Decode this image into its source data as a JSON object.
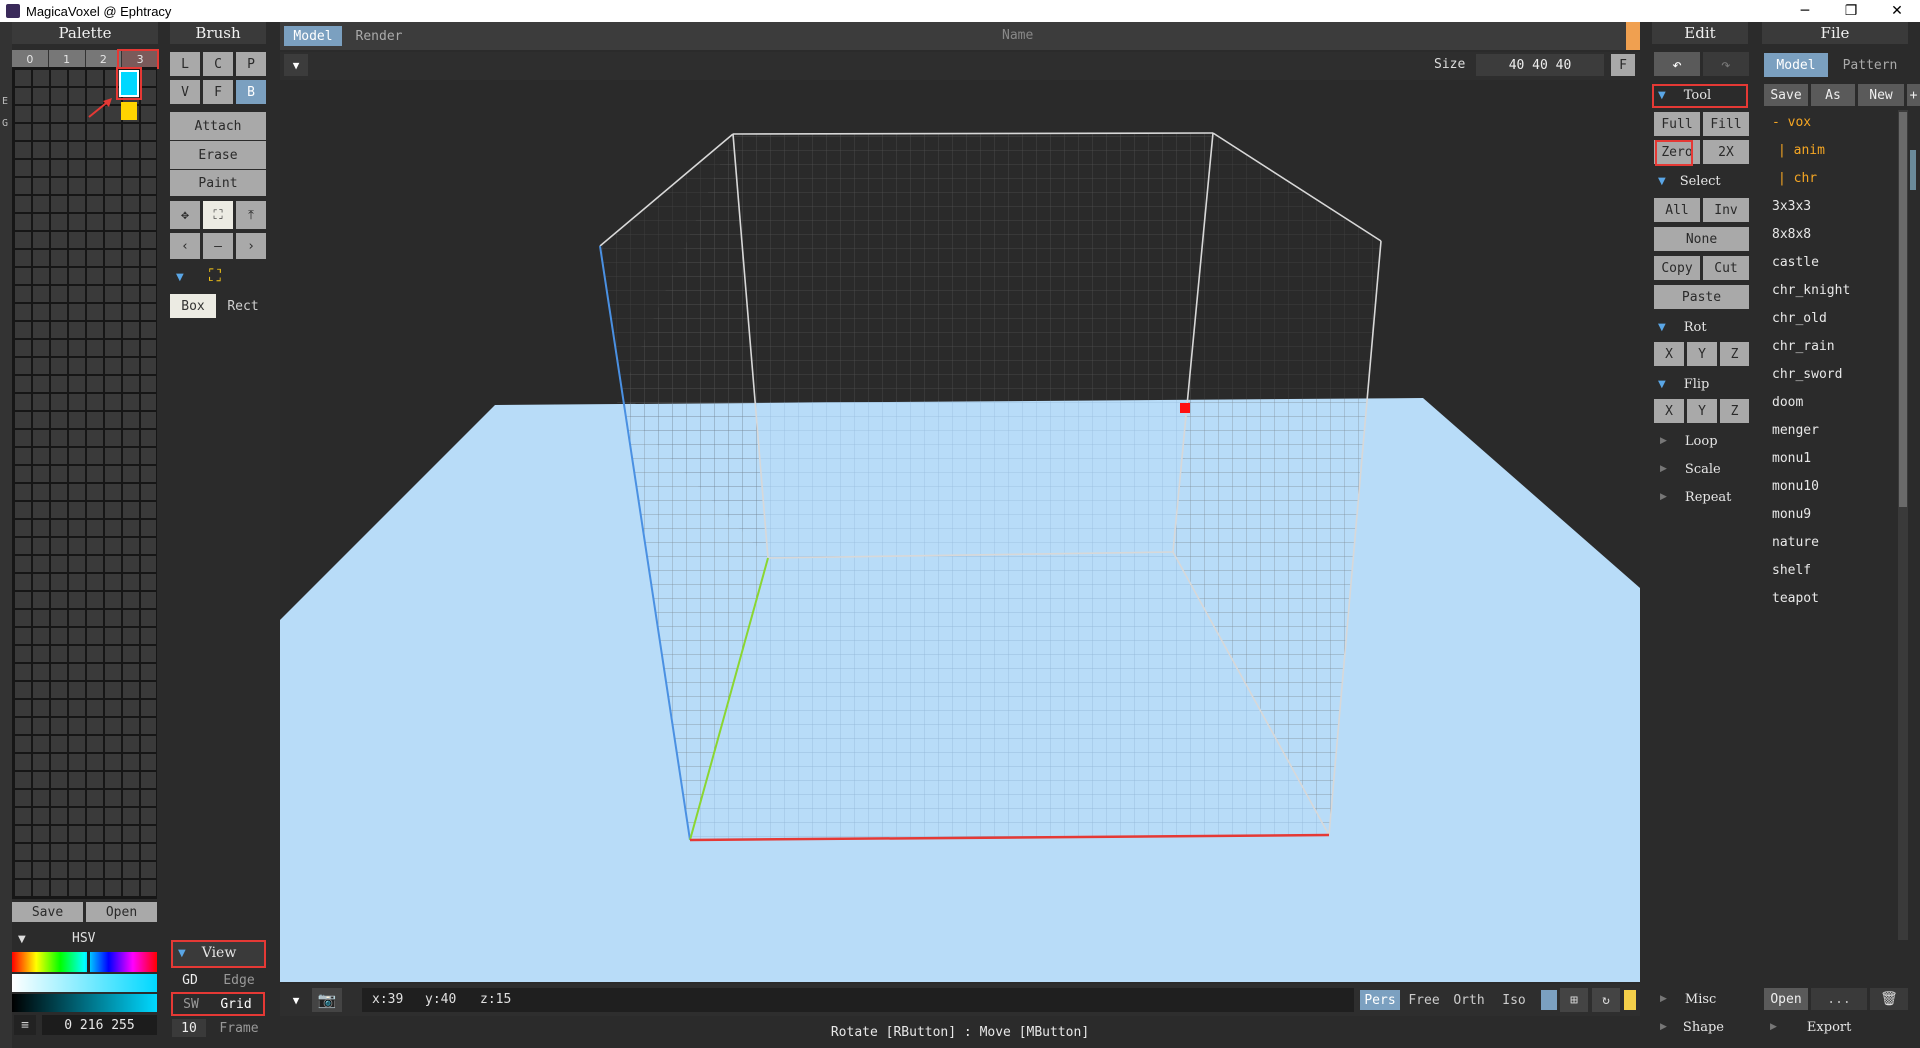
{
  "window": {
    "title": "MagicaVoxel @ Ephtracy",
    "minimize": "─",
    "restore": "❐",
    "close": "✕"
  },
  "palette": {
    "title": "Palette",
    "tabs": [
      "0",
      "1",
      "2",
      "3"
    ],
    "side_labels": [
      "E",
      "G"
    ],
    "save": "Save",
    "open": "Open",
    "hsv_label": "HSV",
    "color_value": "0 216 255",
    "menu_icon": "≡",
    "selected_color": "#00d8ff",
    "second_color": "#ffd400"
  },
  "brush": {
    "title": "Brush",
    "row1": [
      "L",
      "C",
      "P"
    ],
    "row2": [
      "V",
      "F",
      "B"
    ],
    "actions": [
      "Attach",
      "Erase",
      "Paint"
    ],
    "shape_box": "Box",
    "shape_rect": "Rect"
  },
  "view": {
    "title": "View",
    "gd": "GD",
    "edge": "Edge",
    "sw": "SW",
    "grid": "Grid",
    "frame_num": "10",
    "frame": "Frame"
  },
  "viewport": {
    "tab_model": "Model",
    "tab_render": "Render",
    "name": "Name",
    "size_label": "Size",
    "size_value": "40 40 40",
    "f_button": "F",
    "coords": {
      "x": "x:39",
      "y": "y:40",
      "z": "z:15"
    },
    "camera_modes": [
      "Pers",
      "Free",
      "Orth",
      "Iso"
    ],
    "hint": "Rotate [RButton] : Move [MButton]"
  },
  "edit": {
    "title": "Edit",
    "tool": "Tool",
    "full": "Full",
    "fill": "Fill",
    "zero": "Zero",
    "two_x": "2X",
    "select": "Select",
    "all": "All",
    "inv": "Inv",
    "none": "None",
    "copy": "Copy",
    "cut": "Cut",
    "paste": "Paste",
    "rot": "Rot",
    "flip": "Flip",
    "axes": [
      "X",
      "Y",
      "Z"
    ],
    "loop": "Loop",
    "scale": "Scale",
    "repeat": "Repeat",
    "misc": "Misc",
    "shape": "Shape"
  },
  "file": {
    "title": "File",
    "tab_model": "Model",
    "tab_pattern": "Pattern",
    "save": "Save",
    "as": "As",
    "new": "New",
    "plus": "+",
    "folder_vox": "- vox",
    "folder_anim": "| anim",
    "folder_chr": "| chr",
    "items": [
      "3x3x3",
      "8x8x8",
      "castle",
      "chr_knight",
      "chr_old",
      "chr_rain",
      "chr_sword",
      "doom",
      "menger",
      "monu1",
      "monu10",
      "monu9",
      "nature",
      "shelf",
      "teapot"
    ],
    "open": "Open",
    "more": "...",
    "export": "Export"
  }
}
